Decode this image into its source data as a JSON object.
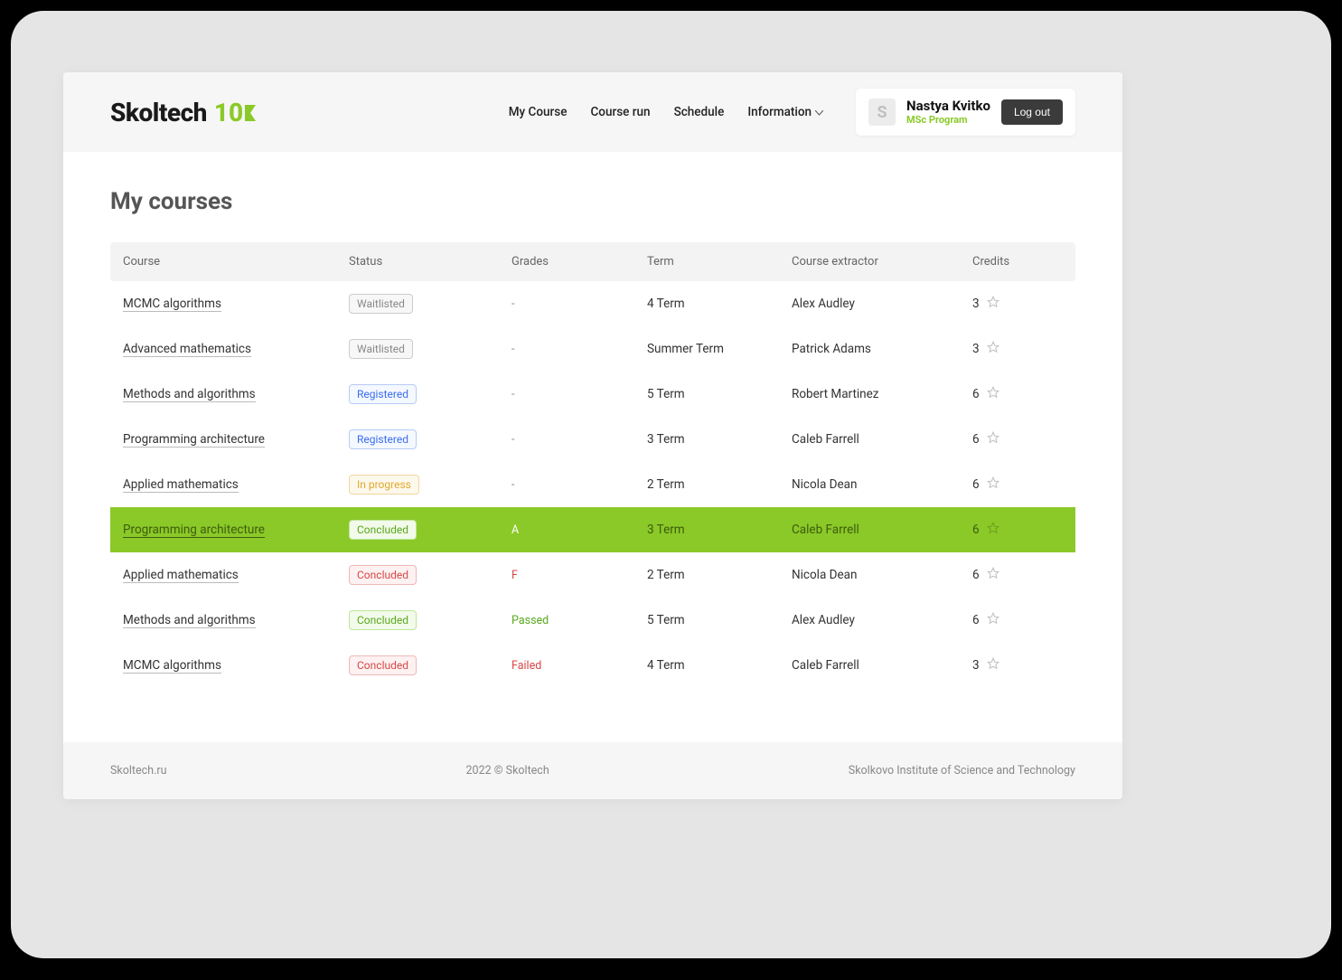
{
  "logo": {
    "text": "Skoltech",
    "number": "10"
  },
  "nav": [
    {
      "label": "My Course"
    },
    {
      "label": "Course run"
    },
    {
      "label": "Schedule"
    },
    {
      "label": "Information",
      "dropdown": true
    }
  ],
  "user": {
    "initial": "S",
    "name": "Nastya Kvitko",
    "program": "MSc Program",
    "logout": "Log out"
  },
  "page_title": "My courses",
  "columns": [
    "Course",
    "Status",
    "Grades",
    "Term",
    "Course extractor",
    "Credits"
  ],
  "rows": [
    {
      "course": "MCMC algorithms",
      "status": "Waitlisted",
      "status_kind": "waitlisted",
      "grade": "-",
      "grade_kind": "",
      "term": "4 Term",
      "extractor": "Alex Audley",
      "credits": "3",
      "highlight": false
    },
    {
      "course": "Advanced mathematics",
      "status": "Waitlisted",
      "status_kind": "waitlisted",
      "grade": "-",
      "grade_kind": "",
      "term": "Summer Term",
      "extractor": "Patrick Adams",
      "credits": "3",
      "highlight": false
    },
    {
      "course": "Methods and algorithms",
      "status": "Registered",
      "status_kind": "registered",
      "grade": "-",
      "grade_kind": "",
      "term": "5 Term",
      "extractor": "Robert Martinez",
      "credits": "6",
      "highlight": false
    },
    {
      "course": "Programming architecture",
      "status": "Registered",
      "status_kind": "registered",
      "grade": "-",
      "grade_kind": "",
      "term": "3 Term",
      "extractor": "Caleb Farrell",
      "credits": "6",
      "highlight": false
    },
    {
      "course": "Applied mathematics",
      "status": "In progress",
      "status_kind": "inprogress",
      "grade": "-",
      "grade_kind": "",
      "term": "2 Term",
      "extractor": "Nicola Dean",
      "credits": "6",
      "highlight": false
    },
    {
      "course": "Programming architecture",
      "status": "Concluded",
      "status_kind": "concluded-green",
      "grade": "A",
      "grade_kind": "a",
      "term": "3 Term",
      "extractor": "Caleb Farrell",
      "credits": "6",
      "highlight": true
    },
    {
      "course": "Applied mathematics",
      "status": "Concluded",
      "status_kind": "concluded-red",
      "grade": "F",
      "grade_kind": "f",
      "term": "2 Term",
      "extractor": "Nicola Dean",
      "credits": "6",
      "highlight": false
    },
    {
      "course": "Methods and algorithms",
      "status": "Concluded",
      "status_kind": "concluded-green",
      "grade": "Passed",
      "grade_kind": "passed",
      "term": "5 Term",
      "extractor": "Alex Audley",
      "credits": "6",
      "highlight": false
    },
    {
      "course": "MCMC algorithms",
      "status": "Concluded",
      "status_kind": "concluded-red",
      "grade": "Failed",
      "grade_kind": "failed",
      "term": "4 Term",
      "extractor": "Caleb Farrell",
      "credits": "3",
      "highlight": false
    }
  ],
  "footer": {
    "left": "Skoltech.ru",
    "center": "2022 © Skoltech",
    "right": "Skolkovo Institute of Science and Technology"
  }
}
